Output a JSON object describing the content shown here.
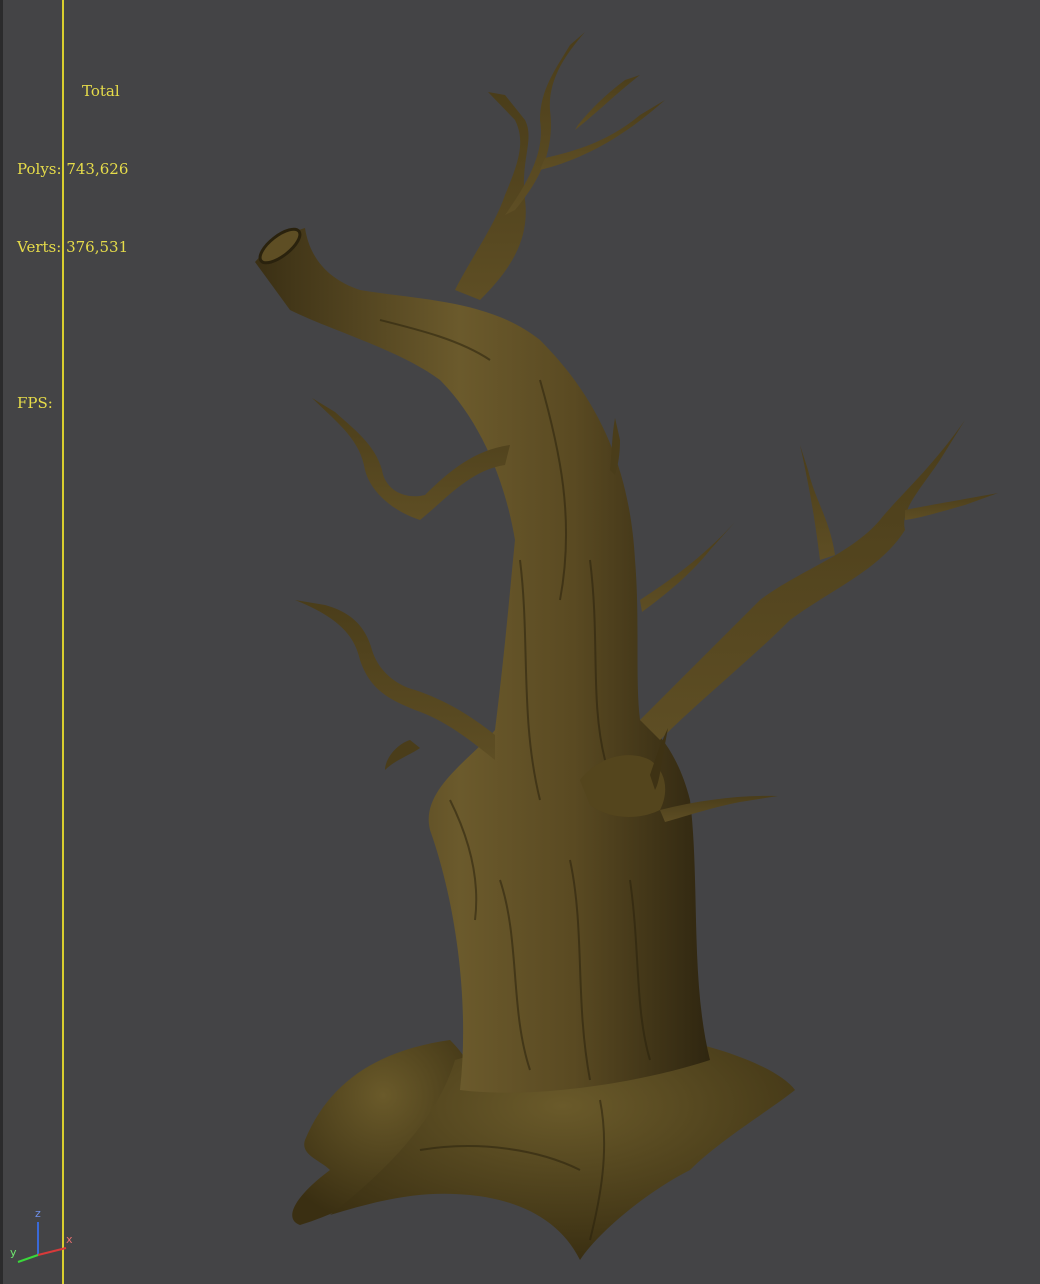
{
  "viewport": {
    "background": "#444446",
    "border_color": "#d9cf2e"
  },
  "stats": {
    "title": "Total",
    "polys_label": "Polys:",
    "polys_value": "743,626",
    "verts_label": "Verts:",
    "verts_value": "376,531",
    "fps_label": "FPS:",
    "text_color": "#e6dc4a"
  },
  "model": {
    "name": "dead-tree-model",
    "bark_color": "#5a4a22"
  },
  "axis_gizmo": {
    "labels": {
      "x": "x",
      "y": "y",
      "z": "z"
    },
    "icon": "axis-tripod-icon"
  }
}
